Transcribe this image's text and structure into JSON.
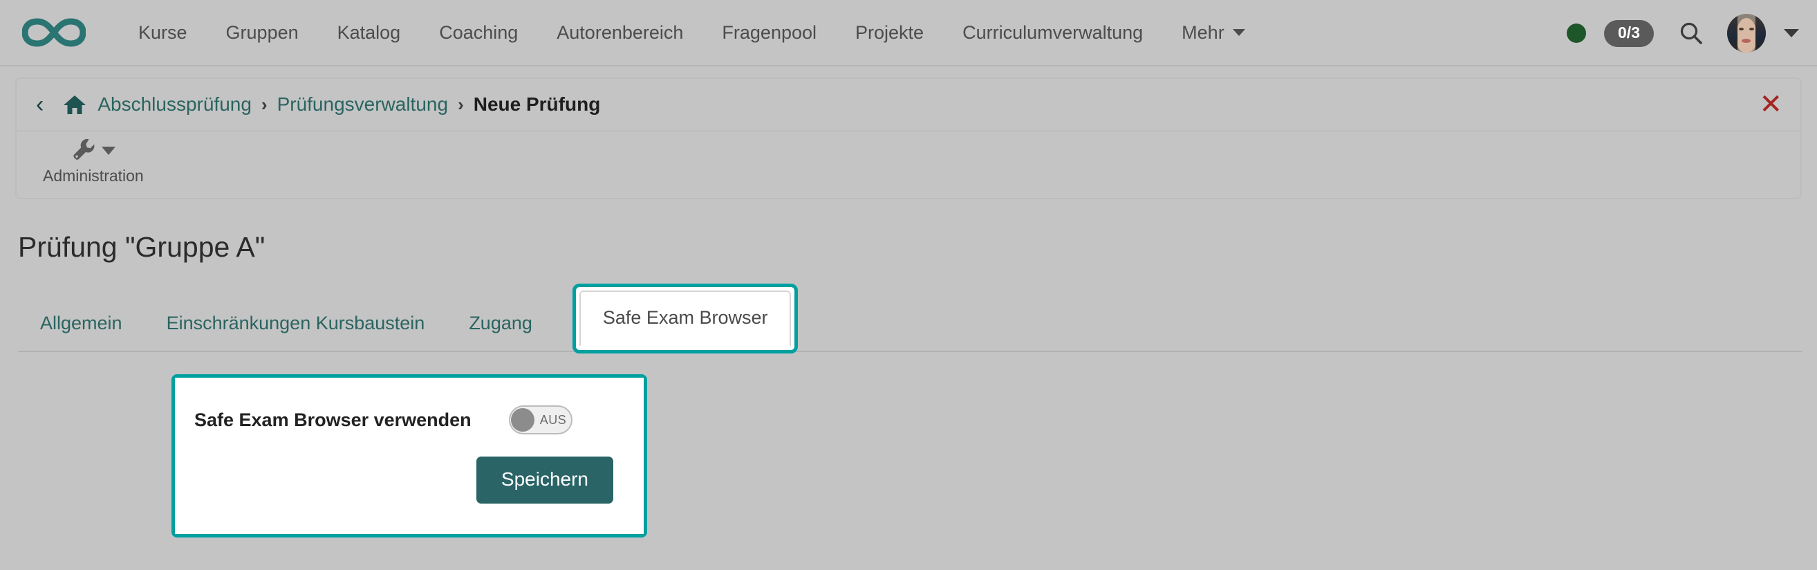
{
  "navbar": {
    "brand_icon": "infinity-logo",
    "links": [
      {
        "label": "Kurse"
      },
      {
        "label": "Gruppen"
      },
      {
        "label": "Katalog"
      },
      {
        "label": "Coaching"
      },
      {
        "label": "Autorenbereich"
      },
      {
        "label": "Fragenpool"
      },
      {
        "label": "Projekte"
      },
      {
        "label": "Curriculumverwaltung"
      },
      {
        "label": "Mehr"
      }
    ],
    "status_dot_color": "#1d5628",
    "task_count": "0/3",
    "search_icon": "search-icon",
    "avatar_alt": "user-avatar",
    "user_menu_icon": "chevron-down-icon"
  },
  "breadcrumb": {
    "back_icon": "chevron-left-icon",
    "home_icon": "home-icon",
    "separator": "›",
    "items": [
      {
        "label": "Abschlussprüfung",
        "current": false
      },
      {
        "label": "Prüfungsverwaltung",
        "current": false
      },
      {
        "label": "Neue Prüfung",
        "current": true
      }
    ],
    "close_label": "✕"
  },
  "toolbar": {
    "items": [
      {
        "label": "Administration",
        "icon": "wrench-icon",
        "has_caret": true
      }
    ]
  },
  "main": {
    "page_title": "Prüfung \"Gruppe A\"",
    "tabs": [
      {
        "label": "Allgemein",
        "active": false
      },
      {
        "label": "Einschränkungen Kursbaustein",
        "active": false
      },
      {
        "label": "Zugang",
        "active": false
      },
      {
        "label": "Safe Exam Browser",
        "active": true
      }
    ]
  },
  "seb_panel": {
    "label": "Safe Exam Browser verwenden",
    "toggle_state": "AUS",
    "save_label": "Speichern"
  },
  "colors": {
    "brand_teal": "#2a7472",
    "highlight_teal": "#00a0a0",
    "button_teal": "#2a6467",
    "link_teal": "#2a6460",
    "page_bg": "#c4c4c4",
    "close_red": "#a52422",
    "status_green": "#1d5628"
  }
}
